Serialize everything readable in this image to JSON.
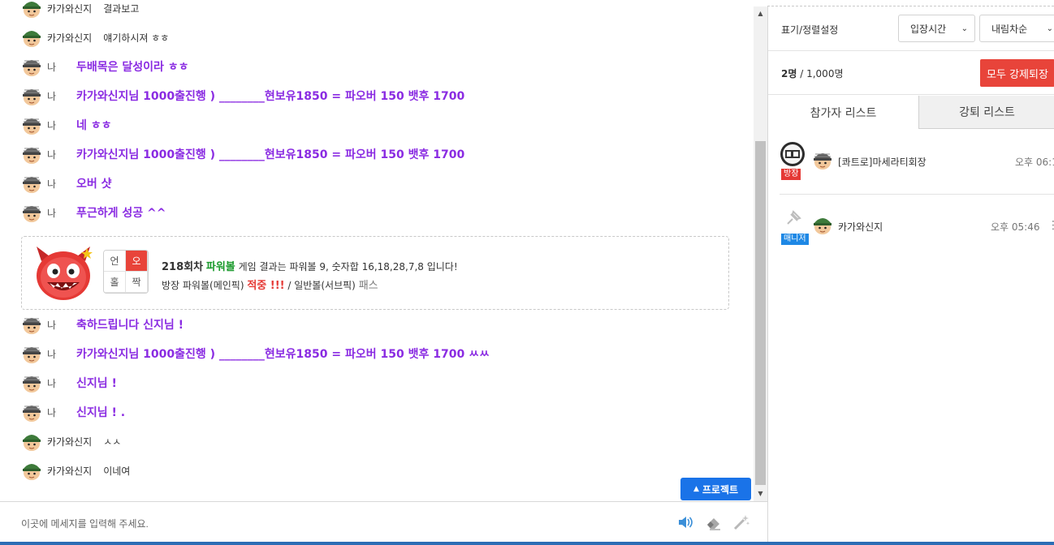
{
  "chat": {
    "messages": [
      {
        "nick": "카가와신지",
        "text": "결과보고",
        "me": false
      },
      {
        "nick": "카가와신지",
        "text": "얘기하시져 ㅎㅎ",
        "me": false
      },
      {
        "nick": "나",
        "text": "두배목은 달성이라 ㅎㅎ",
        "me": true
      },
      {
        "nick": "나",
        "text": "카가와신지님 1000출진행 ) ________현보유1850 = 파오버 150 뱃후 1700",
        "me": true
      },
      {
        "nick": "나",
        "text": "네 ㅎㅎ",
        "me": true
      },
      {
        "nick": "나",
        "text": "카가와신지님 1000출진행 ) ________현보유1850 = 파오버 150 뱃후 1700",
        "me": true
      },
      {
        "nick": "나",
        "text": "오버 샷",
        "me": true
      },
      {
        "nick": "나",
        "text": "푸근하게 성공 ^^",
        "me": true
      }
    ],
    "messages_after": [
      {
        "nick": "나",
        "text": "축하드립니다 신지님 !",
        "me": true
      },
      {
        "nick": "나",
        "text": "카가와신지님 1000출진행 ) ________현보유1850 = 파오버 150 뱃후 1700 ㅆㅆ",
        "me": true
      },
      {
        "nick": "나",
        "text": "신지님 !",
        "me": true
      },
      {
        "nick": "나",
        "text": "신지님 ! .",
        "me": true
      },
      {
        "nick": "카가와신지",
        "text": "ㅅㅅ",
        "me": false
      },
      {
        "nick": "카가와신지",
        "text": "이네여",
        "me": false
      }
    ],
    "result": {
      "grid": [
        "언",
        "오",
        "홀",
        "짝"
      ],
      "round": "218회차",
      "game": "파워볼",
      "line1_rest": "게임 결과는 파워볼 9, 숫자합 16,18,28,7,8 입니다!",
      "line2_a": "방장 파워볼(메인픽)",
      "line2_hit": "적중 !!!",
      "line2_b": "/ 일반볼(서브픽)",
      "line2_pass": "패스"
    },
    "project_button": "프로젝트",
    "input_placeholder": "이곳에 메세지를 입력해 주세요."
  },
  "sidebar": {
    "sort_label": "표기/정렬설정",
    "sort_select": "입장시간",
    "order_select": "내림차순",
    "count_current": "2명",
    "count_sep": "/",
    "count_max": "1,000명",
    "kick_all_button": "모두 강제퇴장",
    "tab_participants": "참가자 리스트",
    "tab_kicked": "강퇴 리스트",
    "participants": [
      {
        "badge_text": "방장",
        "name": "[콰트로]마세라티회장",
        "time": "오후 06:1"
      },
      {
        "badge_text": "매니저",
        "name": "카가와신지",
        "time": "오후 05:46"
      }
    ]
  },
  "colors": {
    "my_message": "#8a2be2",
    "accent_blue": "#1a73e8",
    "danger_red": "#e8443a",
    "success_green": "#1a9a2c"
  }
}
